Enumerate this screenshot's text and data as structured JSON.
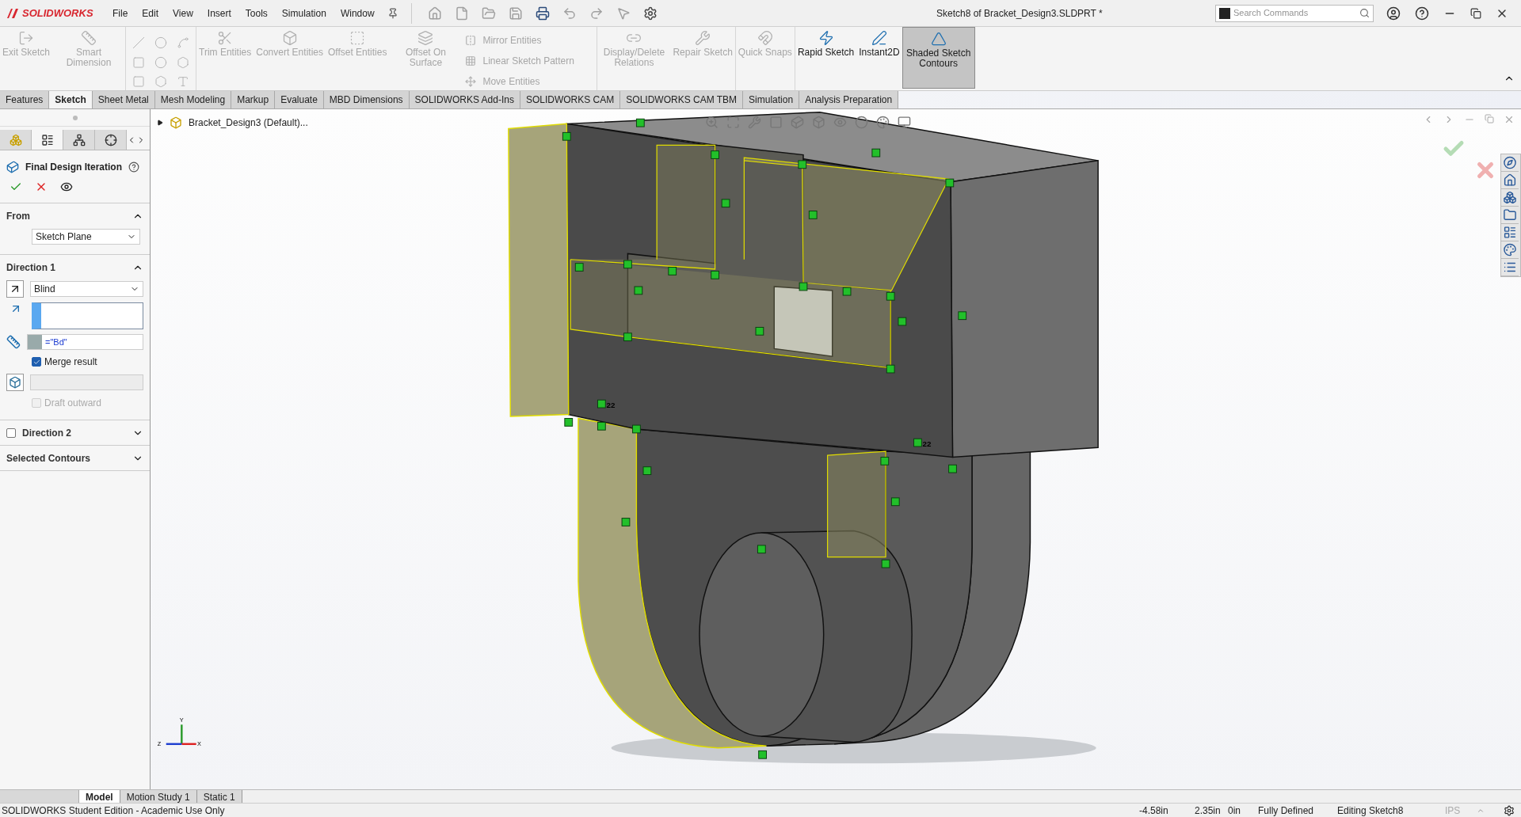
{
  "title_bar": {
    "logo": "SOLIDWORKS",
    "menu": [
      "File",
      "Edit",
      "View",
      "Insert",
      "Tools",
      "Simulation",
      "Window"
    ],
    "document_title": "Sketch8 of Bracket_Design3.SLDPRT *",
    "search": {
      "placeholder": "Search Commands"
    }
  },
  "ribbon": [
    {
      "items": [
        {
          "kind": "big",
          "label": "Exit Sketch",
          "disabled": true,
          "pressed": false
        },
        {
          "kind": "big",
          "label": "Smart Dimension",
          "disabled": true,
          "pressed": false
        }
      ]
    },
    {
      "items": [
        {
          "kind": "icon_grid",
          "disabled": true
        }
      ]
    },
    {
      "items": [
        {
          "kind": "big",
          "label": "Trim Entities",
          "disabled": true,
          "pressed": false
        },
        {
          "kind": "big",
          "label": "Convert Entities",
          "disabled": true,
          "pressed": false
        },
        {
          "kind": "big",
          "label": "Offset Entities",
          "disabled": true,
          "pressed": false
        },
        {
          "kind": "big",
          "label": "Offset On Surface",
          "disabled": true,
          "pressed": false
        },
        {
          "kind": "list",
          "entries": [
            {
              "label": "Mirror Entities",
              "disabled": true
            },
            {
              "label": "Linear Sketch Pattern",
              "disabled": true
            },
            {
              "label": "Move Entities",
              "disabled": true
            }
          ]
        }
      ]
    },
    {
      "items": [
        {
          "kind": "big",
          "label": "Display/Delete Relations",
          "disabled": true,
          "pressed": false
        },
        {
          "kind": "big",
          "label": "Repair Sketch",
          "disabled": true,
          "pressed": false
        }
      ]
    },
    {
      "items": [
        {
          "kind": "big",
          "label": "Quick Snaps",
          "disabled": true,
          "pressed": false
        }
      ]
    },
    {
      "items": [
        {
          "kind": "big",
          "label": "Rapid Sketch",
          "disabled": false,
          "pressed": false
        },
        {
          "kind": "big",
          "label": "Instant2D",
          "disabled": false,
          "pressed": false
        },
        {
          "kind": "big",
          "label": "Shaded Sketch Contours",
          "disabled": false,
          "pressed": true
        }
      ]
    }
  ],
  "tabs": [
    {
      "label": "Features",
      "selected": false
    },
    {
      "label": "Sketch",
      "selected": true
    },
    {
      "label": "Sheet Metal",
      "selected": false
    },
    {
      "label": "Mesh Modeling",
      "selected": false
    },
    {
      "label": "Markup",
      "selected": false
    },
    {
      "label": "Evaluate",
      "selected": false
    },
    {
      "label": "MBD Dimensions",
      "selected": false
    },
    {
      "label": "SOLIDWORKS Add-Ins",
      "selected": false
    },
    {
      "label": "SOLIDWORKS CAM",
      "selected": false
    },
    {
      "label": "SOLIDWORKS CAM TBM",
      "selected": false
    },
    {
      "label": "Simulation",
      "selected": false
    },
    {
      "label": "Analysis Preparation",
      "selected": false
    }
  ],
  "property_manager": {
    "tabs": [
      {
        "selected": false
      },
      {
        "selected": true
      },
      {
        "selected": false
      },
      {
        "selected": false
      }
    ],
    "title": "Final Design Iteration",
    "from": {
      "title": "From",
      "expanded": true,
      "start": "Sketch Plane"
    },
    "direction_1": {
      "title": "Direction 1",
      "expanded": true,
      "end_condition": "Blind",
      "depth": "=\"Bd\"",
      "merge_result": {
        "label": "Merge result",
        "checked": true
      },
      "draft_outward": {
        "label": "Draft outward",
        "checked": false,
        "disabled": true
      }
    },
    "direction_2": {
      "title": "Direction 2",
      "checked": false,
      "expanded": false
    },
    "selected_contours": {
      "title": "Selected Contours",
      "expanded": false
    }
  },
  "feature_tree": {
    "root": "Bracket_Design3 (Default)...",
    "expanded": false
  },
  "viewport": {
    "relation_labels": [
      "22",
      "22"
    ],
    "axes": [
      "Y",
      "Z",
      "X"
    ]
  },
  "bottom_tabs": [
    {
      "label": "Model",
      "selected": true
    },
    {
      "label": "Motion Study 1",
      "selected": false
    },
    {
      "label": "Static 1",
      "selected": false
    }
  ],
  "status_bar": {
    "edition": "SOLIDWORKS Student Edition - Academic Use Only",
    "x": "-4.58in",
    "y": "2.35in",
    "z": "0in",
    "sketch_state": "Fully Defined",
    "mode": "Editing Sketch8",
    "units": "IPS"
  }
}
